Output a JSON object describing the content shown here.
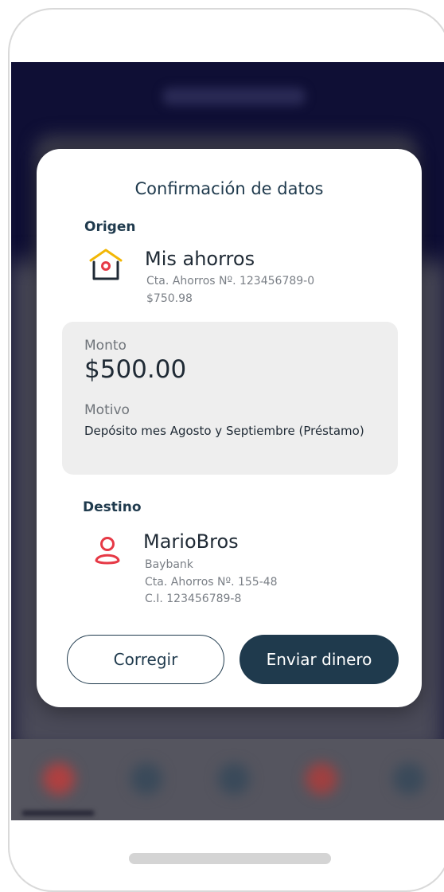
{
  "modal": {
    "title": "Confirmación de datos",
    "origin": {
      "label": "Origen",
      "account_name": "Mis ahorros",
      "account_number": "Cta. Ahorros Nº. 123456789-0",
      "balance": "$750.98"
    },
    "summary": {
      "amount_label": "Monto",
      "amount": "$500.00",
      "reason_label": "Motivo",
      "reason": "Depósito mes Agosto y Septiembre (Préstamo)"
    },
    "destination": {
      "label": "Destino",
      "name": "MarioBros",
      "bank": "Baybank",
      "account_number": "Cta. Ahorros Nº. 155-48",
      "id_number": "C.I. 123456789-8"
    },
    "buttons": {
      "correct": "Corregir",
      "send": "Enviar dinero"
    }
  },
  "colors": {
    "primary": "#1f3a4d",
    "house_icon_door": "#e63946",
    "house_icon_roof": "#f2b705",
    "user_icon": "#e63946",
    "overlay_background": "#0f0f35"
  },
  "icons": {
    "origin": "house-icon",
    "destination": "user-icon"
  }
}
